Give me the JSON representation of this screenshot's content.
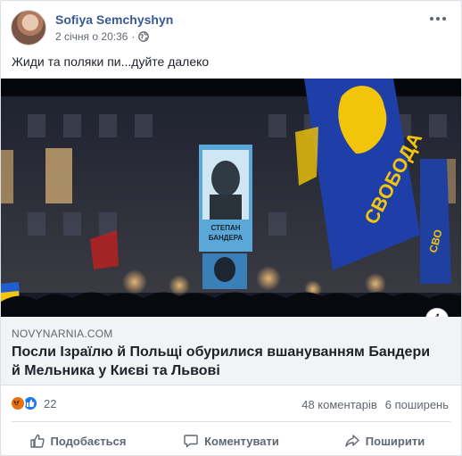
{
  "post": {
    "author": "Sofiya Semchyshyn",
    "timestamp": "2 січня о 20:36",
    "separator": "·",
    "audience_icon": "globe-icon",
    "text": "Жиди та поляки пи...дуйте далеко"
  },
  "image": {
    "poster_caption_line1": "СТЕПАН",
    "poster_caption_line2": "БАНДЕРА",
    "flag_text": "СВОБОДА",
    "flag_text_small": "СВО"
  },
  "link": {
    "domain": "NOVYNARNIA.COM",
    "title": "Посли Ізраїлю й Польщі обурилися вшануванням Бандери й Мельника у Києві та Львові",
    "info_icon": "i"
  },
  "stats": {
    "reaction_icons": [
      "angry-icon",
      "like-icon"
    ],
    "reaction_count": "22",
    "comments": "48 коментарів",
    "shares": "6 поширень"
  },
  "actions": {
    "like": "Подобається",
    "comment": "Коментувати",
    "share": "Поширити"
  },
  "colors": {
    "author_link": "#385898",
    "like_blue": "#1877f2",
    "angry_orange": "#e9710f",
    "flag_blue": "#1f3fa8",
    "flag_yellow": "#f2c40a"
  }
}
